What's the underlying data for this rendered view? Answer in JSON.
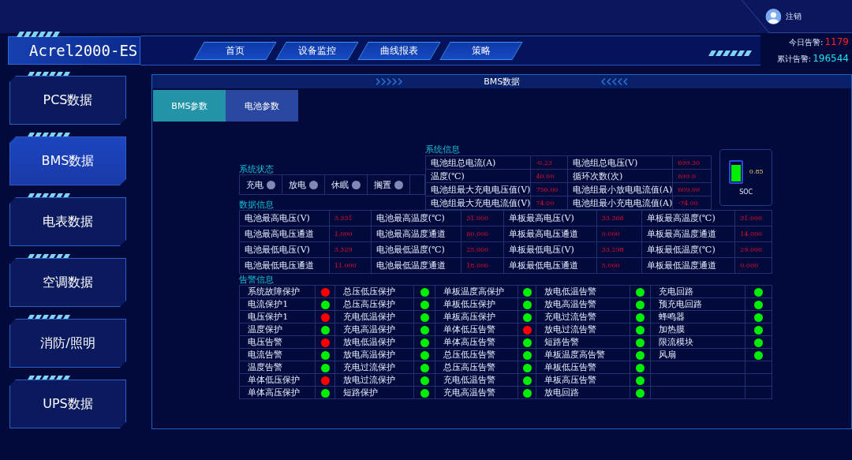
{
  "header": {
    "logo": "Acrel2000-ES",
    "user": "注销",
    "nav": [
      {
        "label": "首页",
        "selected": false
      },
      {
        "label": "设备监控",
        "selected": false
      },
      {
        "label": "曲线报表",
        "selected": false
      },
      {
        "label": "策略",
        "selected": false
      }
    ],
    "alarms": [
      {
        "kind": "today",
        "label": "今日告警:",
        "value": "1179"
      },
      {
        "kind": "total",
        "label": "累计告警:",
        "value": "196544"
      }
    ]
  },
  "sidebar": {
    "items": [
      {
        "label": "PCS数据",
        "selected": false
      },
      {
        "label": "BMS数据",
        "selected": true
      },
      {
        "label": "电表数据",
        "selected": false
      },
      {
        "label": "空调数据",
        "selected": false
      },
      {
        "label": "消防/照明",
        "selected": false
      },
      {
        "label": "UPS数据",
        "selected": false
      }
    ]
  },
  "panel": {
    "title": "BMS数据",
    "tabs": [
      {
        "label": "BMS参数",
        "selected": true
      },
      {
        "label": "电池参数",
        "selected": false
      }
    ],
    "system_status": {
      "title": "系统状态",
      "items": [
        {
          "label": "充电",
          "on": false
        },
        {
          "label": "放电",
          "on": false
        },
        {
          "label": "休眠",
          "on": false
        },
        {
          "label": "搁置",
          "on": false
        }
      ]
    },
    "system_info": {
      "title": "系统信息",
      "rows": [
        [
          {
            "label": "电池组总电流(A)",
            "value": "-0.23"
          },
          {
            "label": "电池组总电压(V)",
            "value": "699.30"
          }
        ],
        [
          {
            "label": "温度(℃)",
            "value": "40.00"
          },
          {
            "label": "循环次数(次)",
            "value": "699.0"
          }
        ],
        [
          {
            "label": "电池组最大充电电压值(V)",
            "value": "756.00"
          },
          {
            "label": "电池组最小放电电流值(A)",
            "value": "609.00"
          }
        ],
        [
          {
            "label": "电池组最大充电电流值(V)",
            "value": "74.00"
          },
          {
            "label": "电池组最小充电电流值(A)",
            "value": "-74.00"
          }
        ]
      ]
    },
    "soc": {
      "label": "SOC",
      "reading": "0.85",
      "level": 0.85
    },
    "data_info": {
      "title": "数据信息",
      "rows": [
        [
          {
            "label": "电池最高电压(V)",
            "value": "3.331"
          },
          {
            "label": "电池最高温度(℃)",
            "value": "31.000"
          },
          {
            "label": "单板最高电压(V)",
            "value": "33.306"
          },
          {
            "label": "单板最高温度(℃)",
            "value": "31.000"
          }
        ],
        [
          {
            "label": "电池最高电压通道",
            "value": "1.000"
          },
          {
            "label": "电池最高温度通道",
            "value": "60.000"
          },
          {
            "label": "单板最高电压通道",
            "value": "0.000"
          },
          {
            "label": "单板最高温度通道",
            "value": "14.000"
          }
        ],
        [
          {
            "label": "电池最低电压(V)",
            "value": "3.329"
          },
          {
            "label": "电池最低温度(℃)",
            "value": "25.000"
          },
          {
            "label": "单板最低电压(V)",
            "value": "33.298"
          },
          {
            "label": "单板最低温度(℃)",
            "value": "29.000"
          }
        ],
        [
          {
            "label": "电池最低电压通道",
            "value": "11.000"
          },
          {
            "label": "电池最低温度通道",
            "value": "18.000"
          },
          {
            "label": "单板最低电压通道",
            "value": "5.000"
          },
          {
            "label": "单板最低温度通道",
            "value": "0.000"
          }
        ]
      ]
    },
    "alarm_info": {
      "title": "告警信息",
      "columns": [
        [
          {
            "label": "系统故障保护",
            "color": "#ff0000"
          },
          {
            "label": "电流保护1",
            "color": "#00ee00"
          },
          {
            "label": "电压保护1",
            "color": "#ff0000"
          },
          {
            "label": "温度保护",
            "color": "#00ee00"
          },
          {
            "label": "电压告警",
            "color": "#ff0000"
          },
          {
            "label": "电流告警",
            "color": "#00ee00"
          },
          {
            "label": "温度告警",
            "color": "#00ee00"
          },
          {
            "label": "单体低压保护",
            "color": "#ff0000"
          },
          {
            "label": "单体高压保护",
            "color": "#00ee00"
          }
        ],
        [
          {
            "label": "总压低压保护",
            "color": "#00ee00"
          },
          {
            "label": "总压高压保护",
            "color": "#00ee00"
          },
          {
            "label": "充电低温保护",
            "color": "#00ee00"
          },
          {
            "label": "充电高温保护",
            "color": "#00ee00"
          },
          {
            "label": "放电低温保护",
            "color": "#00ee00"
          },
          {
            "label": "放电高温保护",
            "color": "#00ee00"
          },
          {
            "label": "充电过流保护",
            "color": "#00ee00"
          },
          {
            "label": "放电过流保护",
            "color": "#00ee00"
          },
          {
            "label": "短路保护",
            "color": "#00ee00"
          }
        ],
        [
          {
            "label": "单板温度高保护",
            "color": "#00ee00"
          },
          {
            "label": "单板低压保护",
            "color": "#00ee00"
          },
          {
            "label": "单板高压保护",
            "color": "#00ee00"
          },
          {
            "label": "单体低压告警",
            "color": "#ff0000"
          },
          {
            "label": "单体高压告警",
            "color": "#00ee00"
          },
          {
            "label": "总压低压告警",
            "color": "#00ee00"
          },
          {
            "label": "总压高压告警",
            "color": "#00ee00"
          },
          {
            "label": "充电低温告警",
            "color": "#00ee00"
          },
          {
            "label": "充电高温告警",
            "color": "#00ee00"
          }
        ],
        [
          {
            "label": "放电低温告警",
            "color": "#00ee00"
          },
          {
            "label": "放电高温告警",
            "color": "#00ee00"
          },
          {
            "label": "充电过流告警",
            "color": "#00ee00"
          },
          {
            "label": "放电过流告警",
            "color": "#00ee00"
          },
          {
            "label": "短路告警",
            "color": "#00ee00"
          },
          {
            "label": "单板温度高告警",
            "color": "#00ee00"
          },
          {
            "label": "单板低压告警",
            "color": "#00ee00"
          },
          {
            "label": "单板高压告警",
            "color": "#00ee00"
          },
          {
            "label": "放电回路",
            "color": "#00ee00"
          }
        ],
        [
          {
            "label": "充电回路",
            "color": "#00ee00"
          },
          {
            "label": "预充电回路",
            "color": "#00ee00"
          },
          {
            "label": "蜂鸣器",
            "color": "#00ee00"
          },
          {
            "label": "加热膜",
            "color": "#00ee00"
          },
          {
            "label": "限流模块",
            "color": "#00ee00"
          },
          {
            "label": "风扇",
            "color": "#00ee00"
          }
        ]
      ]
    }
  }
}
